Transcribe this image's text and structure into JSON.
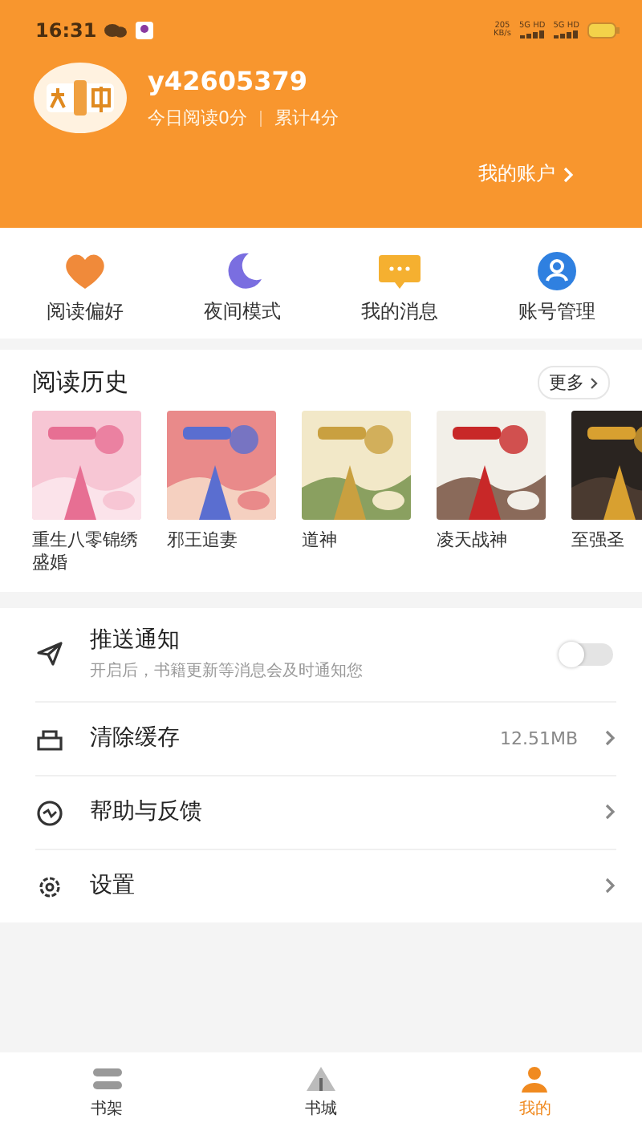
{
  "status_bar": {
    "time": "16:31",
    "speed": "205",
    "speed_unit": "KB/s",
    "networks": [
      "5G HD",
      "5G HD"
    ]
  },
  "profile": {
    "username": "y42605379",
    "today": "今日阅读0分",
    "total": "累计4分",
    "account_link": "我的账户"
  },
  "quick_actions": [
    {
      "kind": "heart",
      "label": "阅读偏好"
    },
    {
      "kind": "moon",
      "label": "夜间模式"
    },
    {
      "kind": "message",
      "label": "我的消息"
    },
    {
      "kind": "person",
      "label": "账号管理"
    }
  ],
  "history": {
    "title": "阅读历史",
    "more": "更多",
    "books": [
      {
        "title": "重生八零锦绣盛婚"
      },
      {
        "title": "邪王追妻"
      },
      {
        "title": "道神"
      },
      {
        "title": "凌天战神"
      },
      {
        "title": "至强圣"
      }
    ]
  },
  "settings": [
    {
      "kind": "toggle",
      "label": "推送通知",
      "hint": "开启后，书籍更新等消息会及时通知您",
      "on": false
    },
    {
      "kind": "link",
      "label": "清除缓存",
      "value": "12.51MB"
    },
    {
      "kind": "link",
      "label": "帮助与反馈"
    },
    {
      "kind": "link",
      "label": "设置"
    }
  ],
  "bottom_nav": [
    {
      "label": "书架",
      "selected": false
    },
    {
      "label": "书城",
      "selected": false
    },
    {
      "label": "我的",
      "selected": true
    }
  ]
}
